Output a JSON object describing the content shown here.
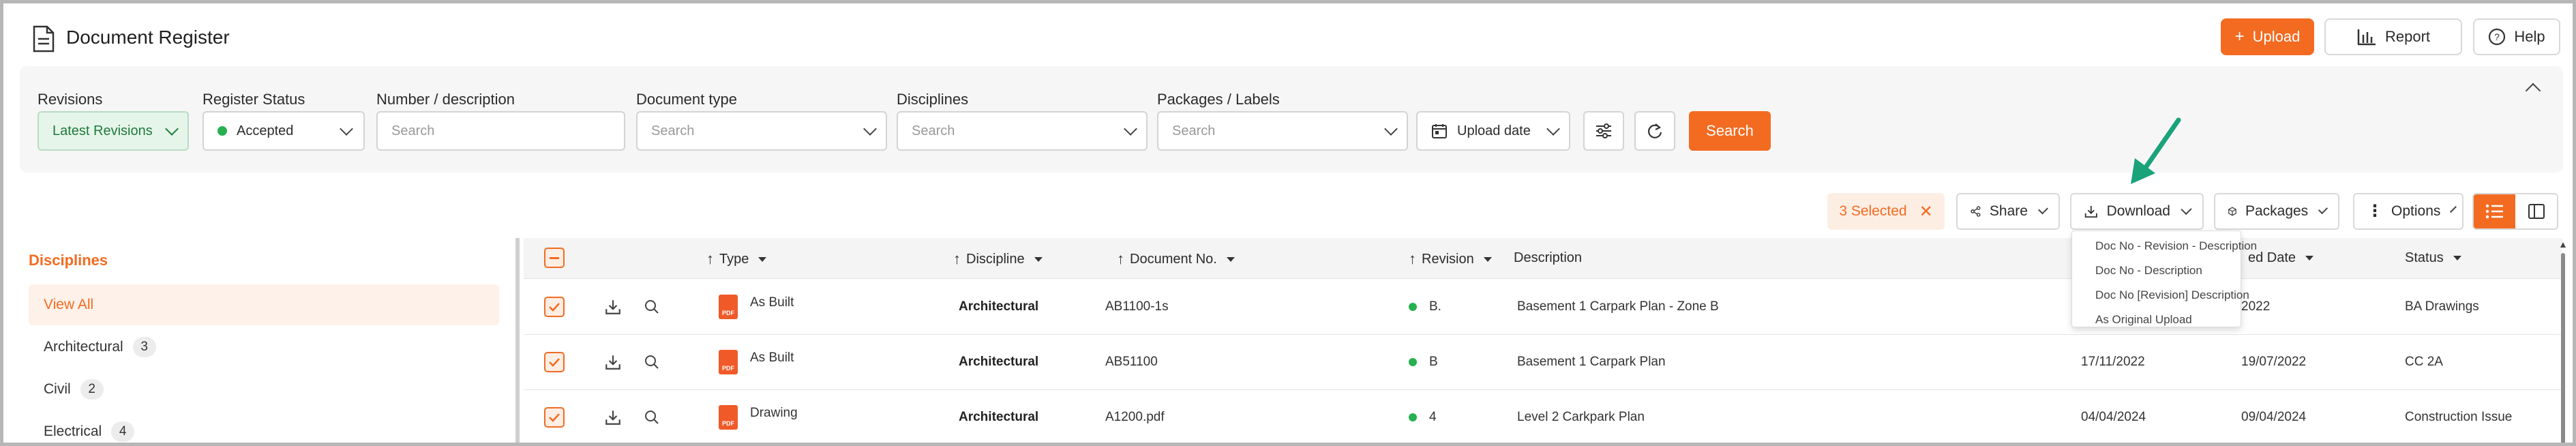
{
  "header": {
    "title": "Document Register",
    "upload_label": "Upload",
    "report_label": "Report",
    "help_label": "Help"
  },
  "filters": {
    "revisions": {
      "label": "Revisions",
      "value": "Latest Revisions"
    },
    "register_status": {
      "label": "Register Status",
      "value": "Accepted"
    },
    "number_description": {
      "label": "Number / description",
      "placeholder": "Search"
    },
    "document_type": {
      "label": "Document type",
      "placeholder": "Search"
    },
    "disciplines": {
      "label": "Disciplines",
      "placeholder": "Search"
    },
    "packages_labels": {
      "label": "Packages / Labels",
      "placeholder": "Search"
    },
    "upload_date": {
      "value": "Upload date"
    },
    "search_label": "Search"
  },
  "toolbar": {
    "selected_label": "3 Selected",
    "share_label": "Share",
    "download_label": "Download",
    "packages_label": "Packages",
    "options_label": "Options"
  },
  "download_menu": [
    "Doc No - Revision - Description",
    "Doc No - Description",
    "Doc No [Revision] Description",
    "As Original Upload"
  ],
  "sidebar": {
    "title": "Disciplines",
    "items": [
      {
        "label": "View All",
        "count": ""
      },
      {
        "label": "Architectural",
        "count": "3"
      },
      {
        "label": "Civil",
        "count": "2"
      },
      {
        "label": "Electrical",
        "count": "4"
      }
    ]
  },
  "table": {
    "columns": {
      "type": "Type",
      "discipline": "Discipline",
      "document_no": "Document No.",
      "revision": "Revision",
      "description": "Description",
      "date": "ed Date",
      "status": "Status"
    },
    "rows": [
      {
        "type": "As Built",
        "discipline": "Architectural",
        "document_no": "AB1100-1s",
        "revision": "B.",
        "description": "Basement 1 Carpark Plan - Zone B",
        "upload_date": "",
        "modified_date": "2022",
        "status": "BA Drawings"
      },
      {
        "type": "As Built",
        "discipline": "Architectural",
        "document_no": "AB51100",
        "revision": "B",
        "description": "Basement 1 Carpark Plan",
        "upload_date": "17/11/2022",
        "modified_date": "19/07/2022",
        "status": "CC 2A"
      },
      {
        "type": "Drawing",
        "discipline": "Architectural",
        "document_no": "A1200.pdf",
        "revision": "4",
        "description": "Level 2 Carkpark Plan",
        "upload_date": "04/04/2024",
        "modified_date": "09/04/2024",
        "status": "Construction Issue"
      }
    ]
  },
  "colors": {
    "accent": "#f36b21",
    "green": "#26b050",
    "arrow": "#1aa37a"
  }
}
